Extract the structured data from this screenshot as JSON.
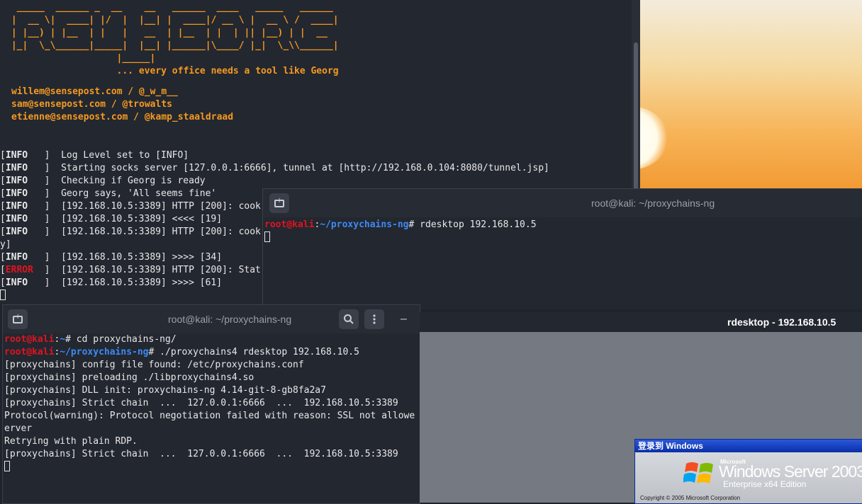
{
  "terminal_back": {
    "banner_lines": [
      "  _____  ______ _  __    __   ______  ____   _____   ______",
      " |  __ \\|  ____| |/  |  |__| |  ____|/ __ \\ |  __ \\ /  ____|",
      " | |__) | |__  | |   |   __  | |__  | |  | || |__) | |  __ ",
      " |_|  \\_\\______|_____|  |__| |______|\\____/ |_|  \\_\\\\______|",
      "                    |_____|"
    ],
    "tagline": "                    ... every office needs a tool like Georg",
    "contacts": [
      "willem@sensepost.com / @_w_m__",
      "sam@sensepost.com / @trowalts",
      "etienne@sensepost.com / @kamp_staaldraad"
    ],
    "logs": [
      {
        "level": "INFO",
        "msg": "Log Level set to [INFO]"
      },
      {
        "level": "INFO",
        "msg": "Starting socks server [127.0.0.1:6666], tunnel at [http://192.168.0.104:8080/tunnel.jsp]"
      },
      {
        "level": "INFO",
        "msg": "Checking if Georg is ready"
      },
      {
        "level": "INFO",
        "msg": "Georg says, 'All seems fine'"
      },
      {
        "level": "INFO",
        "msg": "[192.168.10.5:3389] HTTP [200]: cook"
      },
      {
        "level": "INFO",
        "msg": "[192.168.10.5:3389] <<<< [19]"
      },
      {
        "level": "INFO",
        "msg": "[192.168.10.5:3389] HTTP [200]: cook"
      },
      {
        "level": "",
        "msg": "y]"
      },
      {
        "level": "INFO",
        "msg": "[192.168.10.5:3389] >>>> [34]"
      },
      {
        "level": "ERROR",
        "msg": "[192.168.10.5:3389] HTTP [200]: Stat"
      },
      {
        "level": "INFO",
        "msg": "[192.168.10.5:3389] >>>> [61]"
      }
    ]
  },
  "terminal_mid": {
    "title": "root@kali: ~/proxychains-ng",
    "prompt_user": "root@kali",
    "prompt_path": "~/proxychains-ng",
    "command": "rdesktop 192.168.10.5"
  },
  "terminal_front": {
    "title": "root@kali: ~/proxychains-ng",
    "prompt_user": "root@kali",
    "line1_path": "~",
    "line1_cmd": "cd proxychains-ng/",
    "line2_path": "~/proxychains-ng",
    "line2_cmd": "./proxychains4 rdesktop 192.168.10.5",
    "output": [
      "[proxychains] config file found: /etc/proxychains.conf",
      "[proxychains] preloading ./libproxychains4.so",
      "[proxychains] DLL init: proxychains-ng 4.14-git-8-gb8fa2a7",
      "[proxychains] Strict chain  ...  127.0.0.1:6666  ...  192.168.10.5:3389",
      "Protocol(warning): Protocol negotiation failed with reason: SSL not allowe",
      "erver",
      "Retrying with plain RDP.",
      "[proxychains] Strict chain  ...  127.0.0.1:6666  ...  192.168.10.5:3389"
    ],
    "minimize_symbol": "–"
  },
  "rdesktop": {
    "title": "rdesktop - 192.168.10.5",
    "login_title": "登录到 Windows",
    "microsoft": "Microsoft",
    "product": "Windows Server 2003",
    "edition": "Enterprise x64 Edition",
    "copyright": "Copyright © 2005  Microsoft Corporation"
  },
  "icons": {
    "new_tab": "new-tab-icon",
    "search": "search-icon",
    "menu": "kebab-menu-icon",
    "minimize": "minimize-icon"
  }
}
